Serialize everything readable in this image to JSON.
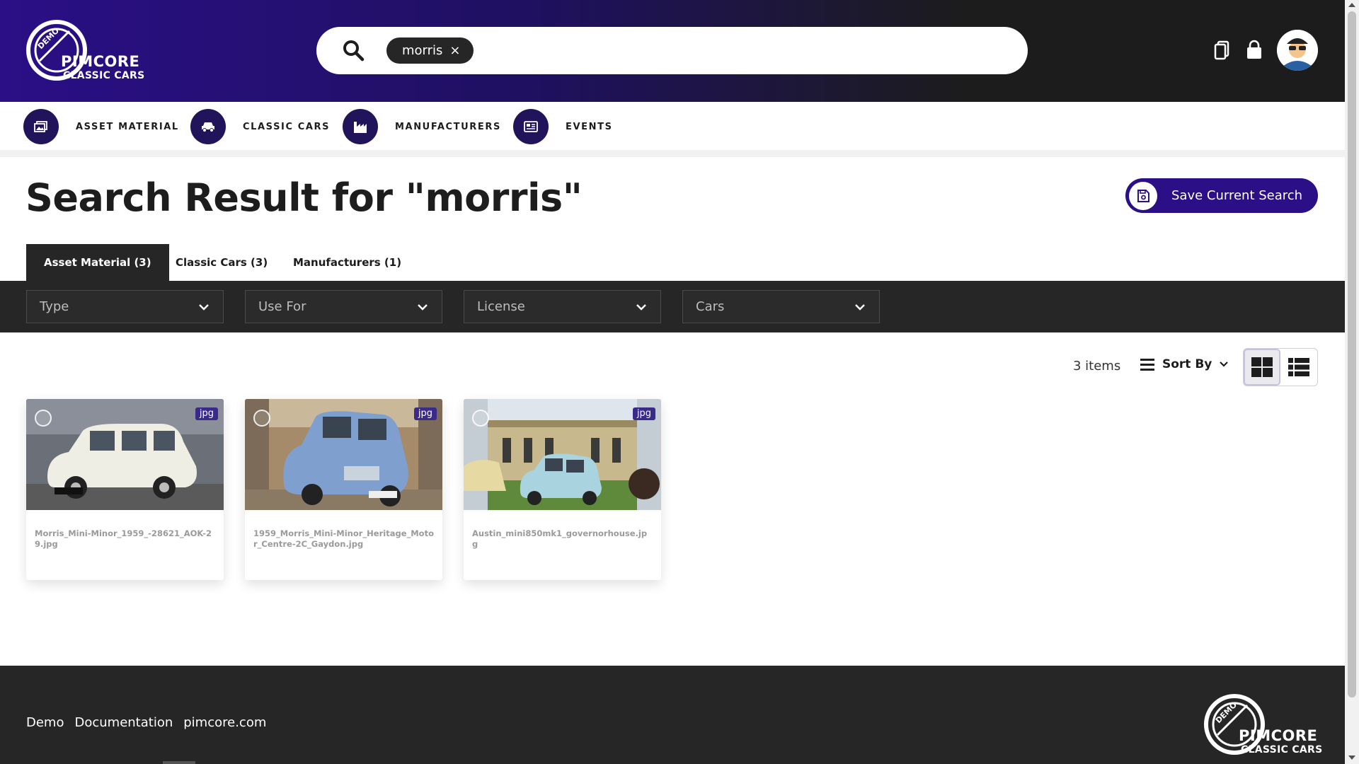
{
  "brand": {
    "logo_badge": "DEMO",
    "logo_main": "PIMCORE",
    "logo_sub": "CLASSIC CARS"
  },
  "header": {
    "search_chip": "morris",
    "search_chip_remove": "×"
  },
  "nav": {
    "items": [
      {
        "label": "ASSET MATERIAL",
        "icon": "gallery-icon"
      },
      {
        "label": "CLASSIC CARS",
        "icon": "car-icon"
      },
      {
        "label": "MANUFACTURERS",
        "icon": "factory-icon"
      },
      {
        "label": "EVENTS",
        "icon": "news-icon"
      }
    ]
  },
  "page": {
    "title": "Search Result for \"morris\"",
    "save_search_label": "Save Current Search"
  },
  "tabs": [
    {
      "label": "Asset Material (3)",
      "active": true
    },
    {
      "label": "Classic Cars (3)",
      "active": false
    },
    {
      "label": "Manufacturers (1)",
      "active": false
    }
  ],
  "filters": [
    {
      "label": "Type"
    },
    {
      "label": "Use For"
    },
    {
      "label": "License"
    },
    {
      "label": "Cars"
    }
  ],
  "results": {
    "count_label": "3 items",
    "sort_label": "Sort By",
    "view_mode": "grid"
  },
  "assets": [
    {
      "name": "Morris_Mini-Minor_1959_-28621_AOK-29.jpg",
      "type": "jpg",
      "car_color": "#efeee4",
      "bg_color": "#6b6f78"
    },
    {
      "name": "1959_Morris_Mini-Minor_Heritage_Motor_Centre-2C_Gaydon.jpg",
      "type": "jpg",
      "car_color": "#7f9fcf",
      "bg_color": "#a68b6a"
    },
    {
      "name": "Austin_mini850mk1_governorhouse.jpg",
      "type": "jpg",
      "car_color": "#a9d3de",
      "bg_color": "#c8b88e"
    }
  ],
  "footer": {
    "links": [
      "Demo",
      "Documentation",
      "pimcore.com"
    ]
  },
  "colors": {
    "brand_purple": "#2a0f86",
    "dark": "#262626"
  }
}
